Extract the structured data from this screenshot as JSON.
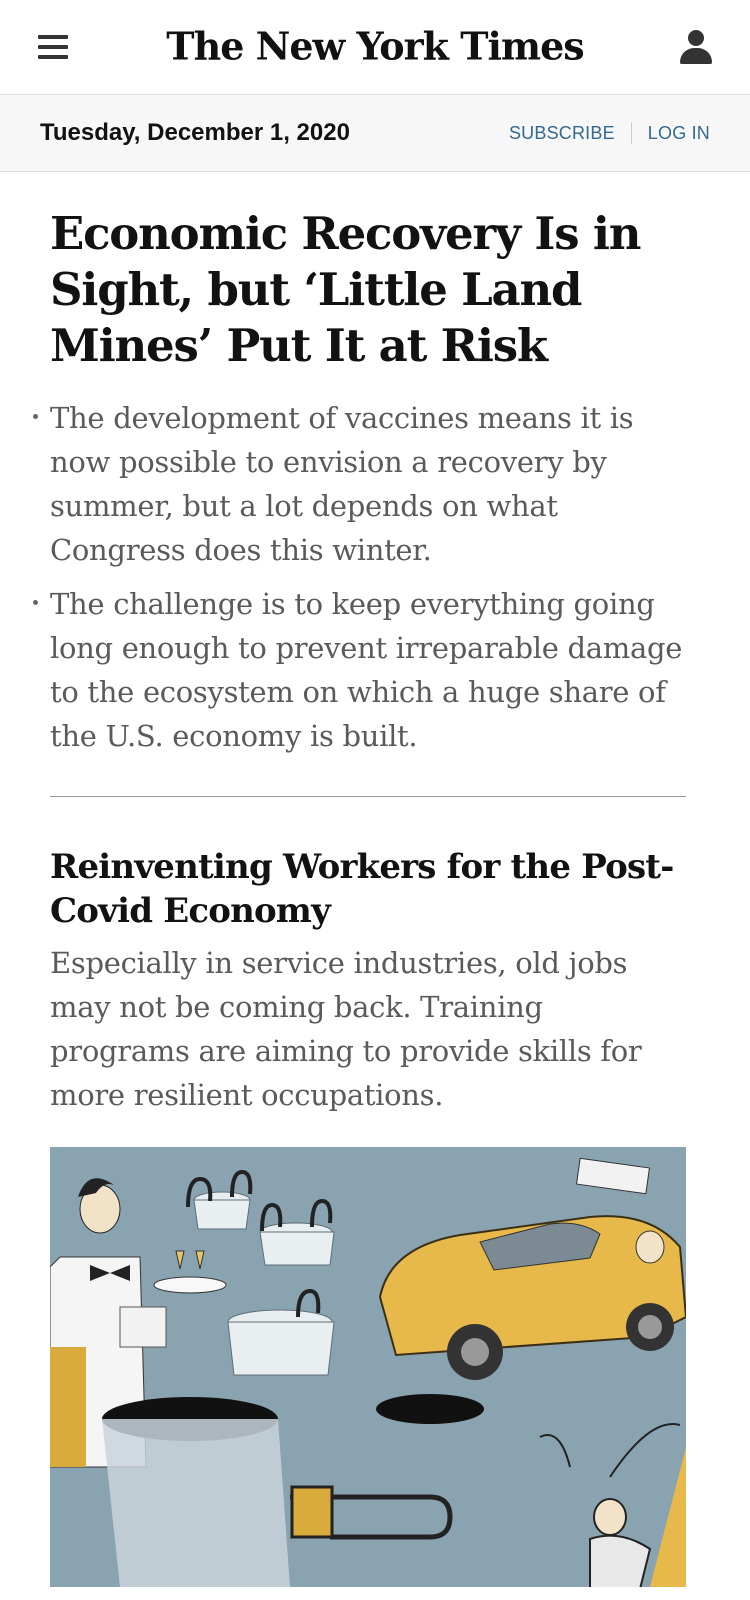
{
  "masthead": {
    "logo": "The New York Times",
    "menu_icon": "hamburger-menu-icon",
    "account_icon": "user-icon"
  },
  "datebar": {
    "date": "Tuesday, December 1, 2020",
    "subscribe": "SUBSCRIBE",
    "login": "LOG IN"
  },
  "lead_story": {
    "headline": "Economic Recovery Is in Sight, but ‘Little Land Mines’ Put It at Risk",
    "bullets": [
      "The development of vaccines means it is now possible to envision a recovery by summer, but a lot depends on what Congress does this winter.",
      "The challenge is to keep everything going long enough to prevent irreparable damage to the ecosystem on which a huge share of the U.S. economy is built."
    ]
  },
  "second_story": {
    "headline": "Reinventing Workers for the Post-Covid Economy",
    "summary": "Especially in service industries, old jobs may not be coming back. Training programs are aiming to provide skills for more resilient occupations."
  },
  "colors": {
    "link": "#326891",
    "illustration_bg": "#8aa3b0",
    "taxi_yellow": "#e6b94a"
  }
}
